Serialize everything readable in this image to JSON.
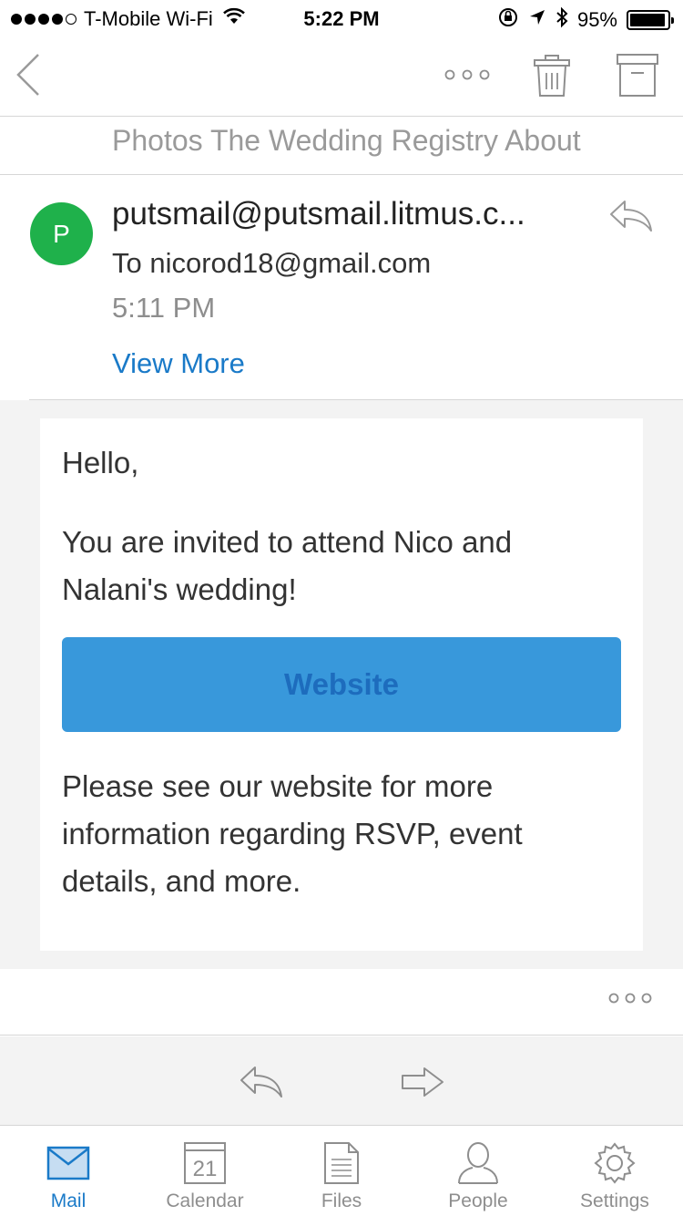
{
  "status_bar": {
    "carrier": "T-Mobile Wi-Fi",
    "time": "5:22 PM",
    "battery": "95%",
    "battery_level": 0.95
  },
  "nav": {
    "back_icon": "chevron-left-icon",
    "more_icon": "more-horizontal-icon",
    "delete_icon": "trash-icon",
    "archive_icon": "archive-icon"
  },
  "header_links": "Photos The Wedding Registry About",
  "message": {
    "avatar_initial": "P",
    "avatar_color": "#1fb14b",
    "from": "putsmail@putsmail.litmus.c...",
    "to": "To nicorod18@gmail.com",
    "time": "5:11 PM",
    "view_more": "View More"
  },
  "body": {
    "greeting": "Hello,",
    "invite": "You are invited to attend Nico and Nalani's wedding!",
    "button_label": "Website",
    "button_color": "#3898db",
    "info": "Please see our website for more information regarding RSVP, event details, and more."
  },
  "tabs": [
    {
      "label": "Mail",
      "icon": "mail-icon",
      "active": true
    },
    {
      "label": "Calendar",
      "icon": "calendar-icon",
      "day": "21"
    },
    {
      "label": "Files",
      "icon": "file-icon"
    },
    {
      "label": "People",
      "icon": "person-icon"
    },
    {
      "label": "Settings",
      "icon": "gear-icon"
    }
  ],
  "accent_color": "#1a7ac8"
}
